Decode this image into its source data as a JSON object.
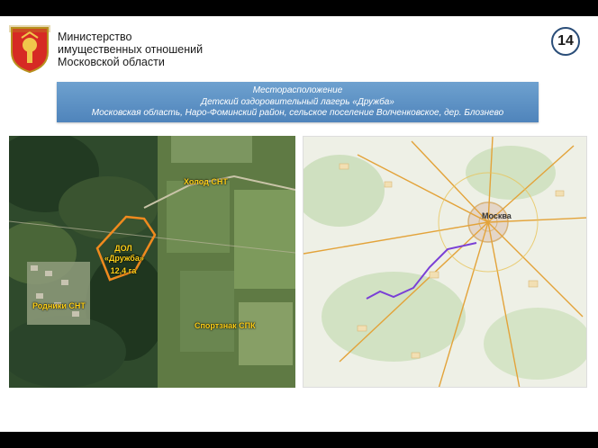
{
  "header": {
    "ministry_line1": "Министерство",
    "ministry_line2": "имущественных отношений",
    "ministry_line3": "Московской области",
    "page_number": "14"
  },
  "banner": {
    "line1": "Месторасположение",
    "line2": "Детский оздоровительный лагерь «Дружба»",
    "line3": "Московская область, Наро-Фоминский район, сельское поселение Волченковское, дер. Блознево"
  },
  "satellite_map": {
    "label_holod": "Холод СНТ",
    "label_dol_line1": "ДОЛ",
    "label_dol_line2": "«Дружба»",
    "label_area": "12,4 га",
    "label_rodniki": "Родники СНТ",
    "label_sportznak": "Спортзнак СПК"
  },
  "road_map": {
    "city": "Москва"
  },
  "colors": {
    "banner": "#5b8fc4",
    "label": "#ffd21a",
    "parcel_outline": "#f08a1e",
    "route": "#7a3fd6"
  }
}
